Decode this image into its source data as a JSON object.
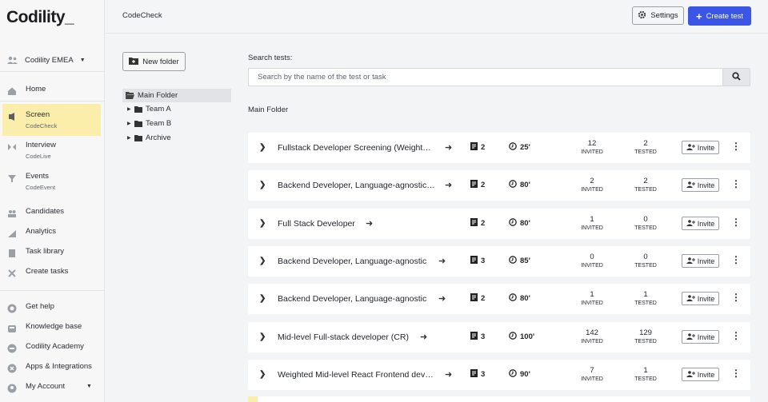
{
  "app": {
    "logo": "Codility"
  },
  "sidebar": {
    "org": {
      "label": "Codility EMEA"
    },
    "items": [
      {
        "label": "Home",
        "icon": "home-icon"
      },
      {
        "label": "Screen",
        "sub": "CodeCheck",
        "icon": "screen-icon"
      },
      {
        "label": "Interview",
        "sub": "CodeLive",
        "icon": "interview-icon"
      },
      {
        "label": "Events",
        "sub": "CodeEvent",
        "icon": "events-icon"
      },
      {
        "label": "Candidates",
        "icon": "candidates-icon"
      },
      {
        "label": "Analytics",
        "icon": "analytics-icon"
      },
      {
        "label": "Task library",
        "icon": "task-library-icon"
      },
      {
        "label": "Create tasks",
        "icon": "create-tasks-icon"
      },
      {
        "label": "Get help",
        "icon": "help-icon"
      },
      {
        "label": "Knowledge base",
        "icon": "knowledge-base-icon"
      },
      {
        "label": "Codility Academy",
        "icon": "academy-icon"
      },
      {
        "label": "Apps & Integrations",
        "icon": "integrations-icon"
      },
      {
        "label": "My Account",
        "icon": "account-icon"
      }
    ]
  },
  "topbar": {
    "breadcrumb": "CodeCheck",
    "settings_label": "Settings",
    "create_label": "Create test"
  },
  "folders": {
    "new_folder_label": "New folder",
    "main": "Main Folder",
    "children": [
      "Team A",
      "Team B",
      "Archive"
    ]
  },
  "search": {
    "label": "Search tests:",
    "placeholder": "Search by the name of the test or task"
  },
  "section_title": "Main Folder",
  "tests": {
    "invited_caption": "INVITED",
    "tested_caption": "TESTED",
    "invite_label": "Invite",
    "rows": [
      {
        "name": "Fullstack Developer Screening (Weight…",
        "tasks": "2",
        "time": "25'",
        "invited": "12",
        "tested": "2"
      },
      {
        "name": "Backend Developer, Language-agnostic…",
        "tasks": "2",
        "time": "80'",
        "invited": "2",
        "tested": "2"
      },
      {
        "name": "Full Stack Developer",
        "tasks": "2",
        "time": "80'",
        "invited": "1",
        "tested": "0"
      },
      {
        "name": "Backend Developer, Language-agnostic",
        "tasks": "3",
        "time": "85'",
        "invited": "0",
        "tested": "0"
      },
      {
        "name": "Backend Developer, Language-agnostic",
        "tasks": "2",
        "time": "80'",
        "invited": "1",
        "tested": "1"
      },
      {
        "name": "Mid-level Full-stack developer (CR)",
        "tasks": "3",
        "time": "100'",
        "invited": "142",
        "tested": "129"
      },
      {
        "name": "Weighted Mid-level React Frontend dev…",
        "tasks": "3",
        "time": "90'",
        "invited": "7",
        "tested": "1"
      }
    ]
  },
  "colors": {
    "primary": "#3b55e6",
    "active_nav": "#fbeeaa"
  }
}
